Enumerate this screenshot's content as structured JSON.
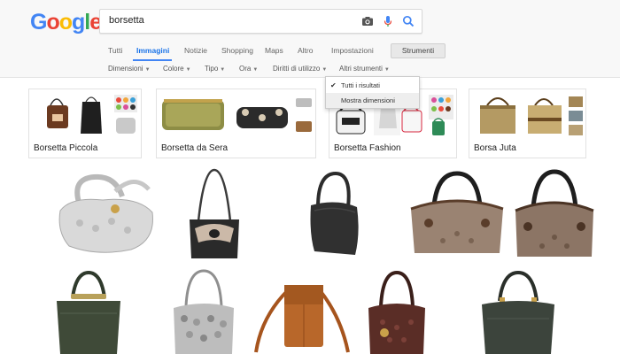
{
  "logo": {
    "letters": [
      "G",
      "o",
      "o",
      "g",
      "l",
      "e"
    ],
    "colors": [
      "#4285F4",
      "#EA4335",
      "#FBBC05",
      "#4285F4",
      "#34A853",
      "#EA4335"
    ]
  },
  "search": {
    "query": "borsetta"
  },
  "tabs": [
    {
      "label": "Tutti",
      "active": false
    },
    {
      "label": "Immagini",
      "active": true
    },
    {
      "label": "Notizie",
      "active": false
    },
    {
      "label": "Shopping",
      "active": false
    },
    {
      "label": "Maps",
      "active": false
    },
    {
      "label": "Altro",
      "active": false
    }
  ],
  "settings_label": "Impostazioni",
  "tools_label": "Strumenti",
  "filters": [
    {
      "label": "Dimensioni"
    },
    {
      "label": "Colore"
    },
    {
      "label": "Tipo"
    },
    {
      "label": "Ora"
    },
    {
      "label": "Diritti di utilizzo"
    },
    {
      "label": "Altri strumenti"
    }
  ],
  "dropdown": {
    "items": [
      {
        "label": "Tutti i risultati",
        "checked": true
      },
      {
        "label": "Mostra dimensioni",
        "checked": false
      }
    ]
  },
  "related": [
    {
      "label": "Borsetta Piccola"
    },
    {
      "label": "Borsetta da Sera"
    },
    {
      "label": "Borsetta Fashion"
    },
    {
      "label": "Borsa Juta"
    }
  ],
  "colors": {
    "accent_blue": "#4285F4",
    "header_bg": "#F8F8F8"
  }
}
